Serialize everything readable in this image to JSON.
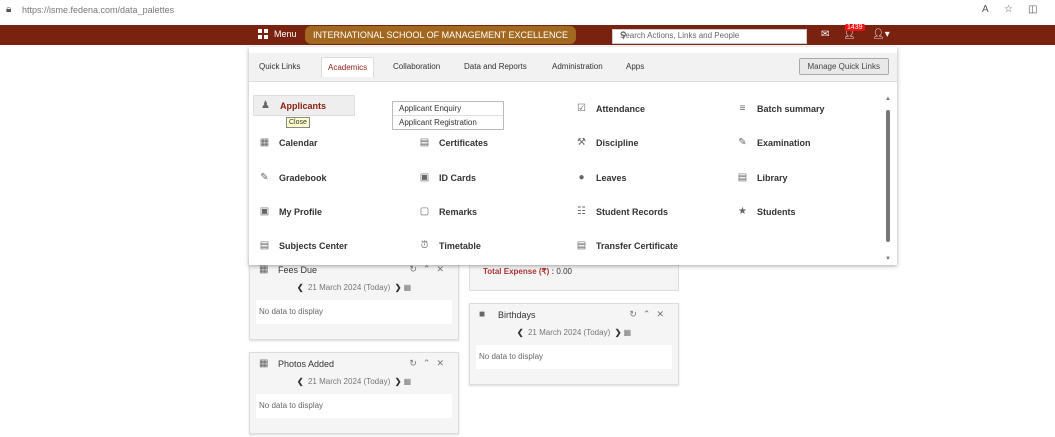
{
  "browser": {
    "url": "https://isme.fedena.com/data_palettes",
    "icons": [
      "lock-icon",
      "read-aloud-icon",
      "favorite-icon",
      "split-screen-icon"
    ]
  },
  "header": {
    "menu_label": "Menu",
    "school_name": "INTERNATIONAL SCHOOL OF MANAGEMENT EXCELLENCE",
    "search_placeholder": "Search Actions, Links and People",
    "notification_count": "1439",
    "brand_color": "#7a2210"
  },
  "mega_menu": {
    "tabs": [
      {
        "label": "Quick Links"
      },
      {
        "label": "Academics"
      },
      {
        "label": "Collaboration"
      },
      {
        "label": "Data and Reports"
      },
      {
        "label": "Administration"
      },
      {
        "label": "Apps"
      }
    ],
    "active_tab": "Academics",
    "manage_label": "Manage Quick Links",
    "items": [
      {
        "label": "Applicants",
        "icon": "user-plus-icon"
      },
      {
        "label": "Attendance",
        "icon": "check-box-icon"
      },
      {
        "label": "Batch summary",
        "icon": "batch-icon"
      },
      {
        "label": "Calendar",
        "icon": "calendar-icon"
      },
      {
        "label": "Certificates",
        "icon": "certificate-icon"
      },
      {
        "label": "Discipline",
        "icon": "discipline-icon"
      },
      {
        "label": "Examination",
        "icon": "examination-icon"
      },
      {
        "label": "Gradebook",
        "icon": "gradebook-icon"
      },
      {
        "label": "ID Cards",
        "icon": "id-card-icon"
      },
      {
        "label": "Leaves",
        "icon": "leaves-icon"
      },
      {
        "label": "Library",
        "icon": "library-icon"
      },
      {
        "label": "My Profile",
        "icon": "profile-icon"
      },
      {
        "label": "Remarks",
        "icon": "remarks-icon"
      },
      {
        "label": "Student Records",
        "icon": "records-icon"
      },
      {
        "label": "Students",
        "icon": "students-icon"
      },
      {
        "label": "Subjects Center",
        "icon": "subjects-icon"
      },
      {
        "label": "Timetable",
        "icon": "timetable-icon"
      },
      {
        "label": "Transfer Certificate",
        "icon": "transfer-icon"
      }
    ],
    "applicants_submenu": [
      "Applicant Enquiry",
      "Applicant Registration"
    ],
    "tooltip": "Close"
  },
  "widgets": {
    "fees_due": {
      "title": "Fees Due",
      "date": "21 March 2024 (Today)",
      "empty": "No data to display"
    },
    "photos_added": {
      "title": "Photos Added",
      "date": "21 March 2024 (Today)",
      "empty": "No data to display"
    },
    "birthdays": {
      "title": "Birthdays",
      "date": "21 March 2024 (Today)",
      "empty": "No data to display"
    },
    "expense": {
      "label": "Total Expense (₹) :",
      "value": "0.00"
    }
  }
}
